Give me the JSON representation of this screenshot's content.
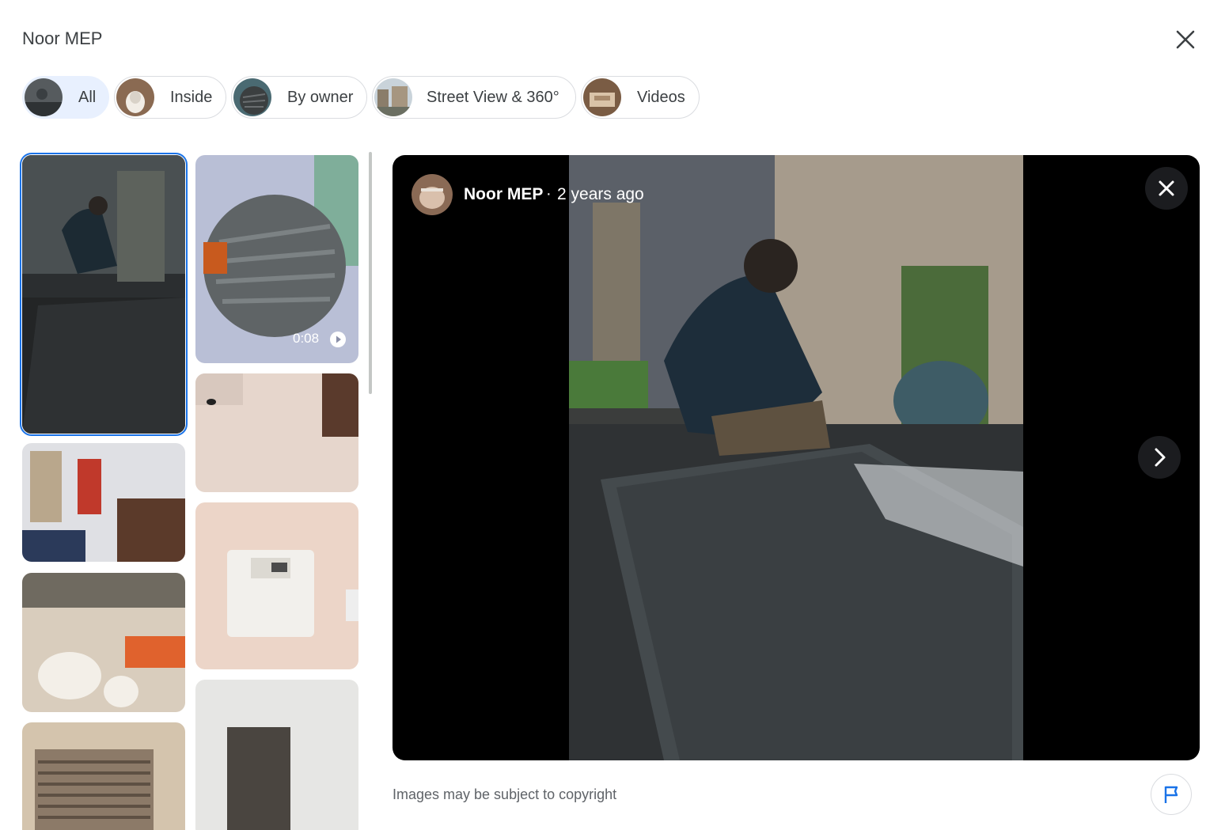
{
  "header": {
    "title": "Noor MEP"
  },
  "icons": {
    "close": "close-icon",
    "next": "chevron-right-icon",
    "flag": "flag-icon",
    "play": "play-icon"
  },
  "chips": [
    {
      "label": "All",
      "active": true
    },
    {
      "label": "Inside",
      "active": false
    },
    {
      "label": "By owner",
      "active": false
    },
    {
      "label": "Street View & 360°",
      "active": false
    },
    {
      "label": "Videos",
      "active": false
    }
  ],
  "grid": {
    "left_column": [
      "man kneeling on dark floor mat",
      "worker fixing wall unit",
      "bathroom with granite counter",
      "wall vent grille"
    ],
    "right_column": [
      "grey finned motor",
      "room doorway with tiled floor",
      "wall-mounted thermostat unit",
      "floor with dark drain mat"
    ],
    "video_duration": "0:08"
  },
  "viewer": {
    "author": "Noor MEP",
    "separator": "·",
    "time_ago": "2 years ago"
  },
  "footer": {
    "copyright": "Images may be subject to copyright"
  },
  "colors": {
    "accent": "#1a73e8",
    "active_chip_bg": "#e8f0fe",
    "viewer_bg": "#000000"
  }
}
